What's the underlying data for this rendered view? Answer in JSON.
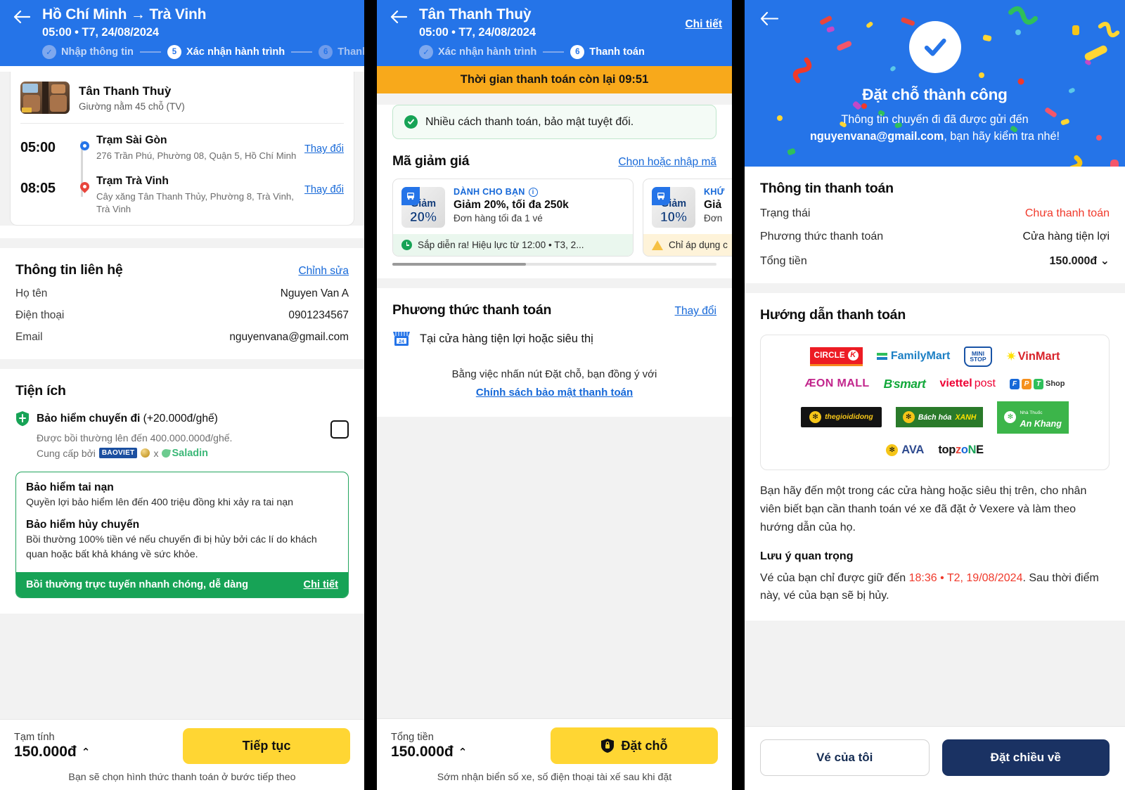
{
  "panel1": {
    "header": {
      "title": "Hồ Chí Minh → Trà Vinh",
      "subtitle": "05:00 • T7, 24/08/2024",
      "steps": [
        {
          "label": "Nhập thông tin",
          "badge": "✓",
          "state": "done"
        },
        {
          "label": "Xác nhận hành trình",
          "badge": "5",
          "state": "active"
        },
        {
          "label": "Thanh",
          "badge": "6",
          "state": "todo"
        }
      ]
    },
    "trip": {
      "operator": "Tân Thanh Thuỳ",
      "vehicle": "Giường nằm 45 chỗ (TV)",
      "legs": [
        {
          "time": "05:00",
          "name": "Trạm Sài Gòn",
          "address": "276 Trần Phú, Phường 08, Quận 5, Hồ Chí Minh",
          "action": "Thay đổi"
        },
        {
          "time": "08:05",
          "name": "Trạm Trà Vinh",
          "address": "Cây xăng Tân Thanh Thủy, Phường 8, Trà Vinh, Trà Vinh",
          "action": "Thay đổi"
        }
      ]
    },
    "contact": {
      "title": "Thông tin liên hệ",
      "edit": "Chỉnh sửa",
      "rows": [
        {
          "k": "Họ tên",
          "v": "Nguyen Van A"
        },
        {
          "k": "Điện thoại",
          "v": "0901234567"
        },
        {
          "k": "Email",
          "v": "nguyenvana@gmail.com"
        }
      ]
    },
    "utilities": {
      "title": "Tiện ích",
      "insurance_title_bold": "Bảo hiểm chuyến đi",
      "insurance_title_light": " (+20.000đ/ghế)",
      "insurance_sub": "Được bồi thường lên đến 400.000.000đ/ghế.",
      "provider_prefix": "Cung cấp bởi",
      "provider_1": "BAOVIET",
      "provider_x": "x",
      "provider_2": "Saladin",
      "green": {
        "h1": "Bảo hiểm tai nạn",
        "p1": "Quyền lợi bảo hiểm lên đến 400 triệu đồng khi xảy ra tai nạn",
        "h2": "Bảo hiểm hủy chuyến",
        "p2": "Bồi thường 100% tiền vé nếu chuyến đi bị hủy bởi các lí do khách quan hoặc bất khả kháng về sức khỏe.",
        "foot": "Bồi thường trực tuyến nhanh chóng, dễ dàng",
        "foot_link": "Chi tiết"
      }
    },
    "bottom": {
      "label": "Tạm tính",
      "amount": "150.000đ",
      "caret": "⌃",
      "cta": "Tiếp tục",
      "note": "Bạn sẽ chọn hình thức thanh toán ở bước tiếp theo"
    }
  },
  "panel2": {
    "header": {
      "title": "Tân Thanh Thuỳ",
      "subtitle": "05:00 • T7, 24/08/2024",
      "detail_link": "Chi tiết",
      "steps": [
        {
          "label": "Xác nhận hành trình",
          "badge": "✓",
          "state": "done"
        },
        {
          "label": "Thanh toán",
          "badge": "6",
          "state": "active"
        }
      ]
    },
    "timer": "Thời gian thanh toán còn lại 09:51",
    "notice": "Nhiều cách thanh toán, bảo mật tuyệt đối.",
    "voucher_section": {
      "title": "Mã giảm giá",
      "link": "Chọn hoặc nhập mã"
    },
    "vouchers": [
      {
        "badge_label": "Giảm",
        "badge_pct": "20%",
        "eyebrow": "DÀNH CHO BẠN",
        "main": "Giảm 20%, tối đa 250k",
        "sub": "Đơn hàng tối đa 1 vé",
        "foot": "Sắp diễn ra! Hiệu lực từ 12:00 • T3, 2...",
        "foot_tone": "green"
      },
      {
        "badge_label": "Giảm",
        "badge_pct": "10%",
        "eyebrow": "KHỨ",
        "main": "Giả",
        "sub": "Đơn",
        "foot": "Chỉ áp dụng c",
        "foot_tone": "amber"
      }
    ],
    "method": {
      "title": "Phương thức thanh toán",
      "link": "Thay đổi",
      "selected": "Tại cửa hàng tiện lợi hoặc siêu thị",
      "agree_text": "Bằng việc nhấn nút Đặt chỗ, bạn đồng ý với",
      "agree_link": "Chính sách bảo mật thanh toán"
    },
    "bottom": {
      "label": "Tổng tiền",
      "amount": "150.000đ",
      "caret": "⌃",
      "cta": "Đặt chỗ",
      "note": "Sớm nhận biển số xe, số điện thoại tài xế sau khi đặt"
    }
  },
  "panel3": {
    "hero": {
      "title": "Đặt chỗ thành công",
      "line1": "Thông tin chuyến đi đã được gửi đến",
      "email": "nguyenvana@gmail.com",
      "line2": ", bạn hãy kiểm tra nhé!"
    },
    "payment_info": {
      "title": "Thông tin thanh toán",
      "rows": [
        {
          "k": "Trạng thái",
          "v": "Chưa thanh toán",
          "tone": "red"
        },
        {
          "k": "Phương thức thanh toán",
          "v": "Cửa hàng tiện lợi",
          "tone": "normal"
        },
        {
          "k": "Tổng tiền",
          "v": "150.000đ",
          "tone": "bold",
          "caret": "⌄"
        }
      ]
    },
    "guide": {
      "title": "Hướng dẫn thanh toán",
      "stores": [
        [
          "CIRCLE K",
          "FamilyMart",
          "MINI STOP",
          "VinMart"
        ],
        [
          "ÆON MALL",
          "B'smart",
          "viettel post",
          "FPT Shop"
        ],
        [
          "thegioididong",
          "Bách hóa XANH",
          "An Khang"
        ],
        [
          "AVA",
          "topzone"
        ]
      ],
      "paragraph": "Bạn hãy đến một trong các cửa hàng hoặc siêu thị trên, cho nhân viên biết bạn cần thanh toán vé xe đã đặt ở Vexere và làm theo hướng dẫn của họ.",
      "note_title": "Lưu ý quan trọng",
      "note_before": "Vé của bạn chỉ được giữ đến ",
      "note_time": "18:36 • T2, 19/08/2024",
      "note_after": ". Sau thời điểm này, vé của bạn sẽ bị hủy."
    },
    "bottom": {
      "secondary": "Vé của tôi",
      "primary": "Đặt chiều về"
    }
  },
  "colors": {
    "brand_blue": "#2574E8",
    "yellow": "#FFD633",
    "amber": "#F8A91B",
    "green": "#17A356",
    "red": "#F0392B",
    "navy": "#1A3263"
  }
}
